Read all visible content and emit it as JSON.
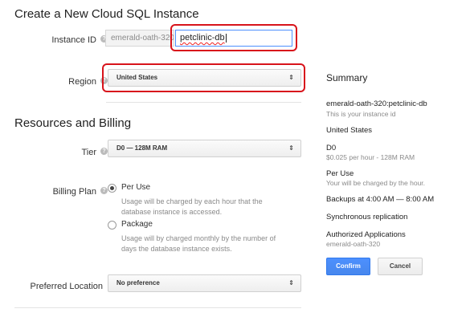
{
  "page": {
    "title": "Create a New Cloud SQL Instance"
  },
  "form": {
    "instance_id": {
      "label": "Instance ID",
      "prefix": "emerald-oath-320",
      "value": "petclinic-db"
    },
    "region": {
      "label": "Region",
      "value": "United States"
    }
  },
  "resources": {
    "title": "Resources and Billing",
    "tier": {
      "label": "Tier",
      "value": "D0 — 128M RAM"
    },
    "billing": {
      "label": "Billing Plan",
      "selected": "Per Use",
      "options": [
        {
          "label": "Per Use",
          "desc_line1": "Usage will be charged by each hour that the",
          "desc_line2": "database instance is accessed."
        },
        {
          "label": "Package",
          "desc_line1": "Usage will by charged monthly by the number of",
          "desc_line2": "days the database instance exists."
        }
      ]
    },
    "location": {
      "label": "Preferred Location",
      "value": "No preference"
    }
  },
  "summary": {
    "title": "Summary",
    "instance_id": "emerald-oath-320:petclinic-db",
    "instance_id_note": "This is your instance id",
    "region": "United States",
    "tier": "D0",
    "tier_note": "$0.025 per hour - 128M RAM",
    "plan": "Per Use",
    "plan_note": "Your will be charged by the hour.",
    "backups": "Backups at 4:00 AM — 8:00 AM",
    "replication": "Synchronous replication",
    "apps_title": "Authorized Applications",
    "apps_value": "emerald-oath-320"
  },
  "buttons": {
    "confirm": "Confirm",
    "cancel": "Cancel"
  },
  "icons": {
    "help": "help-icon",
    "select_arrows": "updown-arrows-icon",
    "radio": "radio-icon"
  },
  "colors": {
    "highlight": "#d8131b",
    "primary": "#4d90fe",
    "muted": "#8a8a8a"
  }
}
